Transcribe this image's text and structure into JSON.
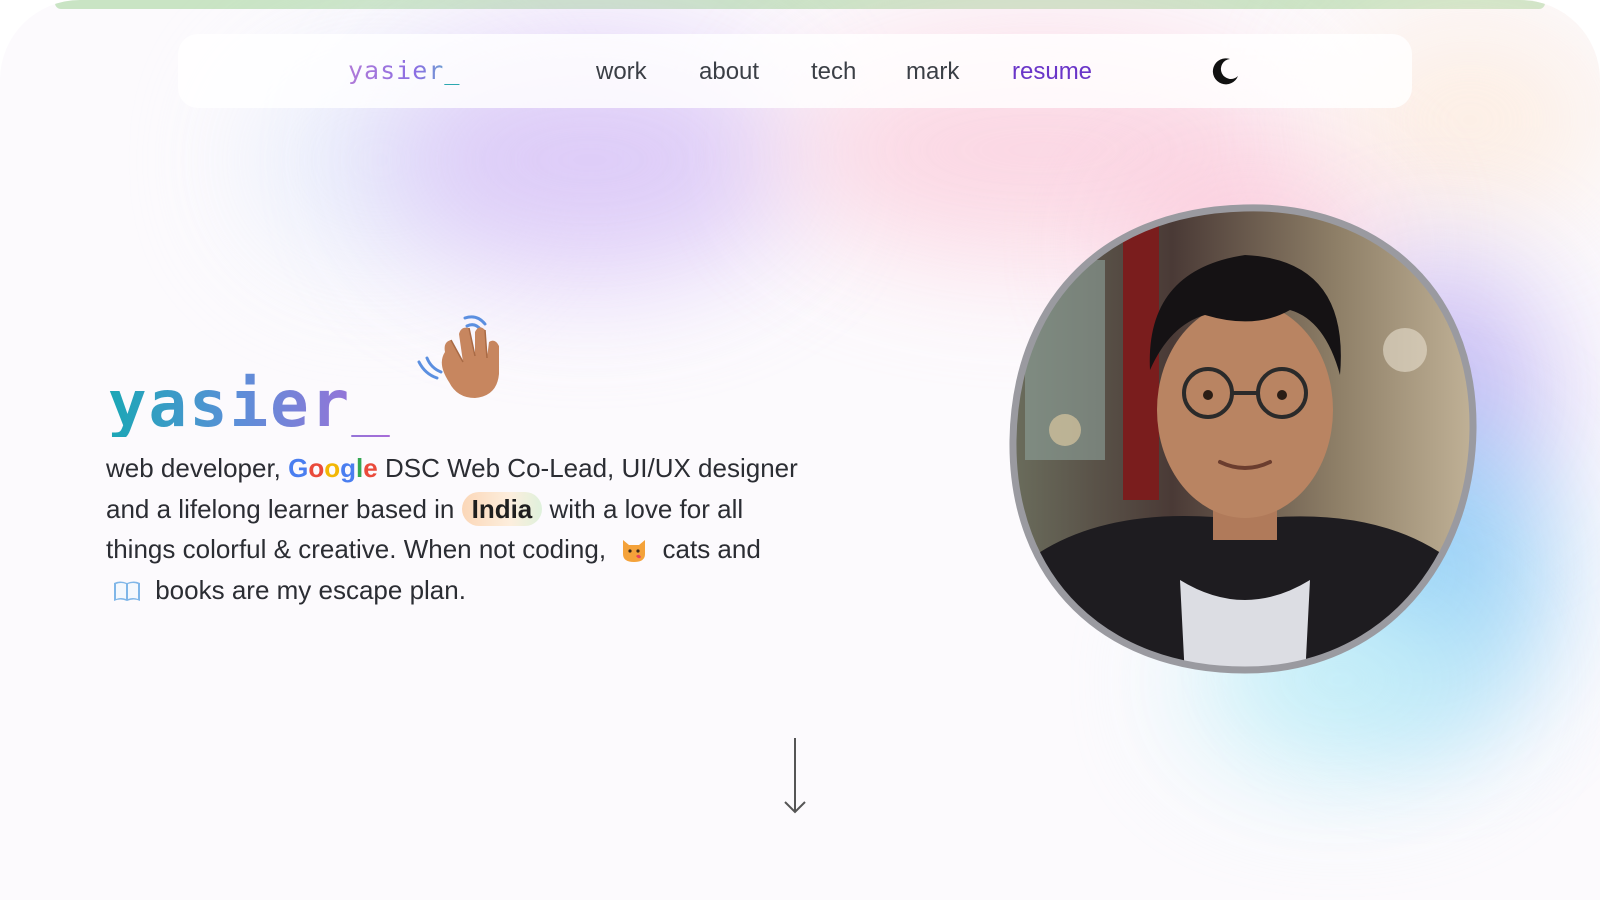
{
  "nav": {
    "logo_main": "yasier",
    "logo_underscore": "_",
    "links": [
      {
        "label": "work"
      },
      {
        "label": "about"
      },
      {
        "label": "tech"
      },
      {
        "label": "mark"
      },
      {
        "label": "resume"
      }
    ],
    "theme_icon": "moon-icon"
  },
  "hero": {
    "title": "yasier_",
    "wave_icon": "waving-hand-icon",
    "bio": {
      "part1": "web developer, ",
      "google": [
        "G",
        "o",
        "o",
        "g",
        "l",
        "e"
      ],
      "part2": " DSC Web Co-Lead, UI/UX designer and a lifelong learner based in ",
      "india": "India",
      "part3": " with a love for all things colorful & creative. When not coding, ",
      "cat_icon": "cat-face-icon",
      "part4": " cats and ",
      "book_icon": "open-book-icon",
      "part5": " books are my escape plan."
    },
    "avatar_icon": "profile-photo",
    "scroll_icon": "arrow-down-icon"
  },
  "colors": {
    "accent": "#6a35c8",
    "title_gradient_start": "#1aa7b5",
    "title_gradient_end": "#a96bd8",
    "google_blue": "#4a7ef0",
    "google_red": "#ea4a3b",
    "google_yellow": "#f2b705",
    "google_green": "#34a853"
  }
}
